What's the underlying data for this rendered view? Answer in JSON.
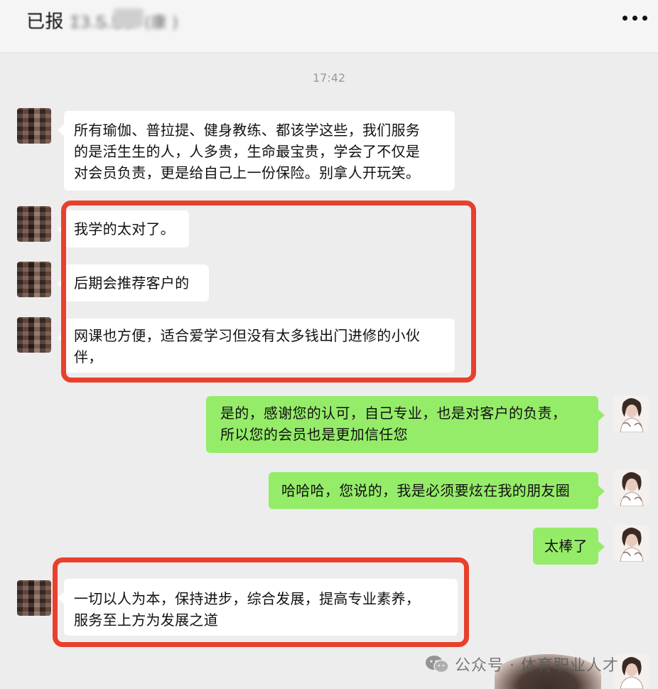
{
  "header": {
    "title_visible": "已报",
    "title_obscured": "Ʃ3.Ƽ.ƼƷ.  (康  )"
  },
  "timestamp": "17:42",
  "messages": [
    {
      "side": "left",
      "lines": [
        "所有瑜伽、普拉提、健身教练、都该学这些，我们服务",
        "的是活生生的人，人多贵，生命最宝贵，学会了不仅是",
        "对会员负责，更是给自己上一份保险。别拿人开玩笑。"
      ]
    },
    {
      "side": "left",
      "lines": [
        "我学的太对了。"
      ]
    },
    {
      "side": "left",
      "lines": [
        "后期会推荐客户的"
      ]
    },
    {
      "side": "left",
      "lines": [
        "网课也方便，适合爱学习但没有太多钱出门进修的小伙",
        "伴，"
      ]
    },
    {
      "side": "right",
      "lines": [
        "是的，感谢您的认可，自己专业，也是对客户的负责，",
        "所以您的会员也是更加信任您"
      ]
    },
    {
      "side": "right",
      "lines": [
        "哈哈哈，您说的，我是必须要炫在我的朋友圈"
      ]
    },
    {
      "side": "right",
      "lines": [
        "太棒了"
      ]
    },
    {
      "side": "left",
      "lines": [
        "一切以人为本，保持进步，综合发展，提高专业素养，",
        "服务至上方为发展之道"
      ]
    }
  ],
  "watermark": "公众号 · 体育职业人才",
  "colors": {
    "background": "#ededed",
    "bubble_left": "#ffffff",
    "bubble_right": "#95ec69",
    "highlight": "#e8402d"
  },
  "icons": {
    "more": "more-dots-icon",
    "watermark": "wechat-icon"
  }
}
